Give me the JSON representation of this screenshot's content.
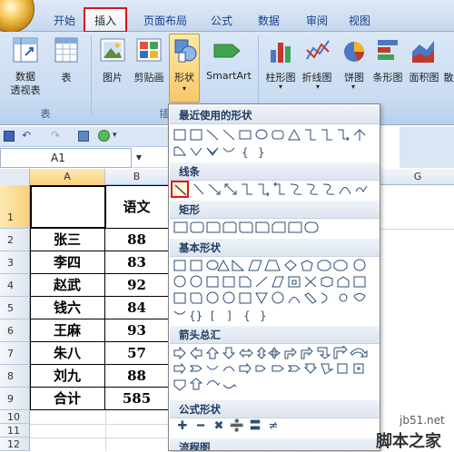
{
  "ribbon": {
    "tabs": [
      "开始",
      "插入",
      "页面布局",
      "公式",
      "数据",
      "审阅",
      "视图"
    ],
    "active_tab": "插入",
    "buttons": {
      "pivot_table": "数据\n透视表",
      "table": "表",
      "picture": "图片",
      "clipart": "剪贴画",
      "shapes": "形状",
      "smartart": "SmartArt",
      "column_chart": "柱形图",
      "line_chart": "折线图",
      "pie_chart": "饼图",
      "bar_chart": "条形图",
      "area_chart": "面积图",
      "scatter_chart": "散"
    },
    "group_labels": {
      "tables": "表",
      "illustrations": "插"
    }
  },
  "namebox": {
    "value": "A1"
  },
  "columns": [
    "A",
    "B",
    "G"
  ],
  "rows": [
    "1",
    "2",
    "3",
    "4",
    "5",
    "6",
    "7",
    "8",
    "9",
    "10",
    "11",
    "12"
  ],
  "sheet": {
    "header": [
      "",
      "语文"
    ],
    "data": [
      [
        "张三",
        "88"
      ],
      [
        "李四",
        "83"
      ],
      [
        "赵武",
        "92"
      ],
      [
        "钱六",
        "84"
      ],
      [
        "王麻",
        "93"
      ],
      [
        "朱八",
        "57"
      ],
      [
        "刘九",
        "88"
      ],
      [
        "合计",
        "585"
      ]
    ]
  },
  "shapes_menu": {
    "sections": [
      "最近使用的形状",
      "线条",
      "矩形",
      "基本形状",
      "箭头总汇",
      "公式形状",
      "流程图"
    ],
    "equation_symbols": [
      "✚",
      "━",
      "✖",
      "➗",
      "〓",
      "≠"
    ]
  },
  "watermark": {
    "line1": "jb51.net",
    "line2": "脚本之家"
  }
}
